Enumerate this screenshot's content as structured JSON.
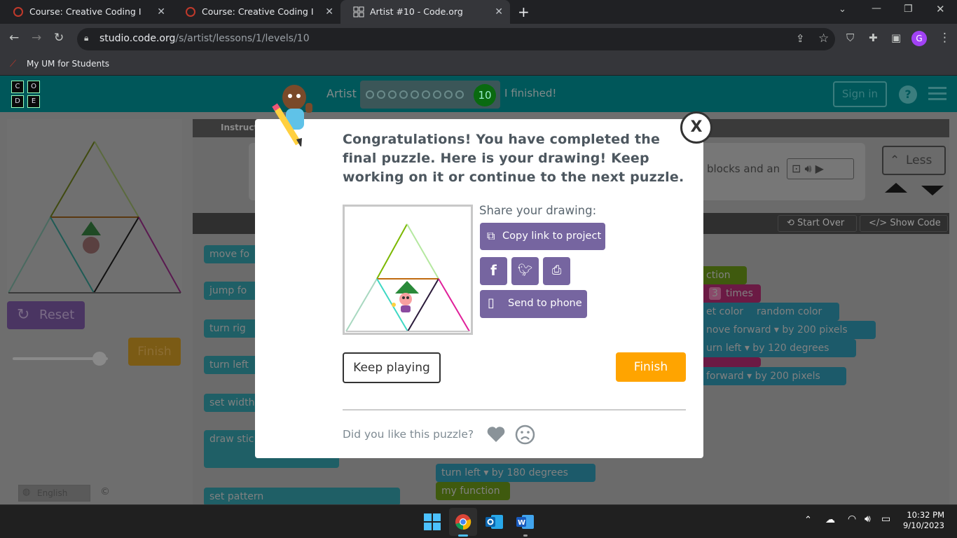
{
  "tabs": [
    {
      "title": "Course: Creative Coding I"
    },
    {
      "title": "Course: Creative Coding I"
    },
    {
      "title": "Artist #10 - Code.org"
    }
  ],
  "address": {
    "host": "studio.code.org",
    "path": "/s/artist/lessons/1/levels/10"
  },
  "profile_initial": "G",
  "bookmarks": [
    {
      "label": "My UM for Students"
    }
  ],
  "header": {
    "logo_letters": [
      "C",
      "O",
      "D",
      "E"
    ],
    "level_title": "Artist",
    "level_number": "10",
    "finished_text": "I finished!",
    "sign_in": "Sign in",
    "help": "?"
  },
  "left_panel": {
    "reset_label": "Reset",
    "finish_label": "Finish",
    "language": "English"
  },
  "instructions": {
    "tab": "Instructi",
    "partial_text": "blocks and an",
    "less_label": "Less"
  },
  "workspace_bar": {
    "start_over": "Start Over",
    "show_code": "Show Code"
  },
  "toolbox_blocks": [
    "move fo",
    "jump fo",
    "turn rig",
    "turn left",
    "set width",
    "draw stic",
    "set pattern"
  ],
  "workspace_blocks": {
    "function_label": "ction",
    "repeat_times": "3",
    "times_label": "times",
    "set_color": "et color",
    "random_color": "random color",
    "move_forward": "nove forward ▾ by",
    "move_value": "200",
    "move_unit": "pixels",
    "turn_left": "urn left ▾ by",
    "turn_value": "120",
    "turn_unit": "degrees",
    "forward2": "forward ▾ by",
    "forward2_value": "200",
    "forward2_unit": "pixels",
    "turn_left_180": "turn left ▾ by",
    "turn180_value": "180",
    "turn180_unit": "degrees",
    "my_function": "my function"
  },
  "modal": {
    "message": "Congratulations! You have completed the final puzzle. Here is your drawing! Keep working on it or continue to the next puzzle.",
    "share_label": "Share your drawing:",
    "copy_link": "Copy link to project",
    "send_to_phone": "Send to phone",
    "keep_playing": "Keep playing",
    "finish": "Finish",
    "feedback_question": "Did you like this puzzle?",
    "close": "X"
  },
  "taskbar": {
    "time": "10:32 PM",
    "date": "9/10/2023"
  },
  "colors": {
    "purple": "#7665a0",
    "orange": "#ffa400",
    "teal": "#00575a"
  }
}
